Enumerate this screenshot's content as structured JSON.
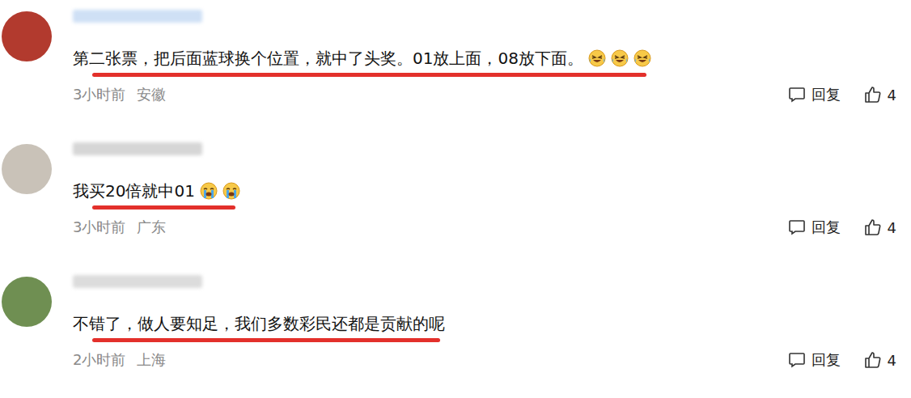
{
  "comments": [
    {
      "text": "第二张票，把后面蓝球换个位置，就中了头奖。01放上面，08放下面。",
      "emojis": [
        {
          "kind": "laugh"
        },
        {
          "kind": "laugh"
        },
        {
          "kind": "laugh"
        }
      ],
      "underlined": true,
      "time": "3小时前",
      "location": "安徽",
      "reply": "回复",
      "likes": "4",
      "avatar_color": "#b23a2e",
      "name_color": "#cfe0f5"
    },
    {
      "text": "我买20倍就中01",
      "emojis": [
        {
          "kind": "cry"
        },
        {
          "kind": "cry"
        }
      ],
      "underlined": true,
      "time": "3小时前",
      "location": "广东",
      "reply": "回复",
      "likes": "4",
      "avatar_color": "#c9c2b8",
      "name_color": "#d6d6d6"
    },
    {
      "text": "不错了，做人要知足，我们多数彩民还都是贡献的呢",
      "emojis": [],
      "underlined": true,
      "time": "2小时前",
      "location": "上海",
      "reply": "回复",
      "likes": "4",
      "avatar_color": "#6f8f52",
      "name_color": "#dcdcdc"
    }
  ]
}
